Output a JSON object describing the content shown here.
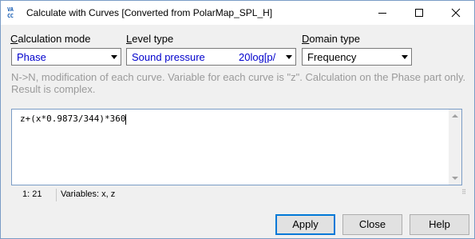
{
  "window": {
    "title": "Calculate with Curves  [Converted from PolarMap_SPL_H]",
    "app_icon_lines": [
      "VA",
      "CC"
    ]
  },
  "controls": {
    "calculation_mode": {
      "label_underlined": "C",
      "label_rest": "alculation mode",
      "value": "Phase"
    },
    "level_type": {
      "label_underlined": "L",
      "label_rest": "evel type",
      "value": "Sound pressure",
      "value_extra": "20log[p/"
    },
    "domain_type": {
      "label_underlined": "D",
      "label_rest": "omain type",
      "value": "Frequency"
    }
  },
  "description": "N->N, modification of each curve. Variable for each curve is \"z\". Calculation on the Phase part only. Result is complex.",
  "editor": {
    "formula": "z+(x*0.9873/344)*360"
  },
  "statusbar": {
    "cursor_position": "1: 21",
    "variables": "Variables: x, z"
  },
  "buttons": {
    "apply": "Apply",
    "close": "Close",
    "help": "Help"
  },
  "colors": {
    "accent": "#0078d7",
    "select_text": "#0000cc",
    "description_text": "#9a9a9a"
  }
}
